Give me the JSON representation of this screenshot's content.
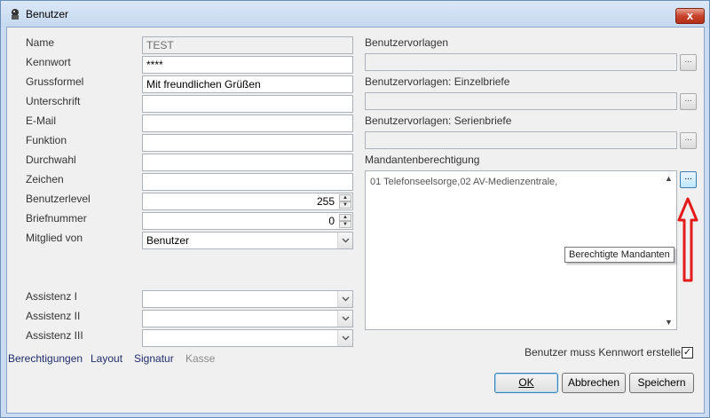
{
  "window": {
    "title": "Benutzer",
    "close_label": "x"
  },
  "left": {
    "fields": [
      {
        "label": "Name",
        "value": "TEST"
      },
      {
        "label": "Kennwort",
        "value": "****"
      },
      {
        "label": "Grussformel",
        "value": "Mit freundlichen Grüßen"
      },
      {
        "label": "Unterschrift",
        "value": ""
      },
      {
        "label": "E-Mail",
        "value": ""
      },
      {
        "label": "Funktion",
        "value": ""
      },
      {
        "label": "Durchwahl",
        "value": ""
      },
      {
        "label": "Zeichen",
        "value": ""
      },
      {
        "label": "Benutzerlevel",
        "value": "255"
      },
      {
        "label": "Briefnummer",
        "value": "0"
      },
      {
        "label": "Mitglied von",
        "value": "Benutzer"
      }
    ],
    "assistenz": [
      {
        "label": "Assistenz I",
        "value": ""
      },
      {
        "label": "Assistenz II",
        "value": ""
      },
      {
        "label": "Assistenz III",
        "value": ""
      }
    ]
  },
  "right": {
    "vorlagen_label": "Benutzervorlagen",
    "einzel_label": "Benutzervorlagen: Einzelbriefe",
    "serien_label": "Benutzervorlagen: Serienbriefe",
    "mandanten_label": "Mandantenberechtigung",
    "mandanten_text": "01 Telefonseelsorge,02 AV-Medienzentrale,",
    "dots": "...",
    "tooltip": "Berechtigte Mandanten",
    "checkbox_label": "Benutzer muss Kennwort erstellen.",
    "checkbox_checked": "✓"
  },
  "links": {
    "berechtigungen": "Berechtigungen",
    "layout": "Layout",
    "signatur": "Signatur",
    "kasse": "Kasse"
  },
  "buttons": {
    "ok": "OK",
    "abbrechen": "Abbrechen",
    "speichern": "Speichern"
  },
  "colors": {
    "accent_red": "#e31b1b",
    "window_frame": "#c9dcf1"
  }
}
